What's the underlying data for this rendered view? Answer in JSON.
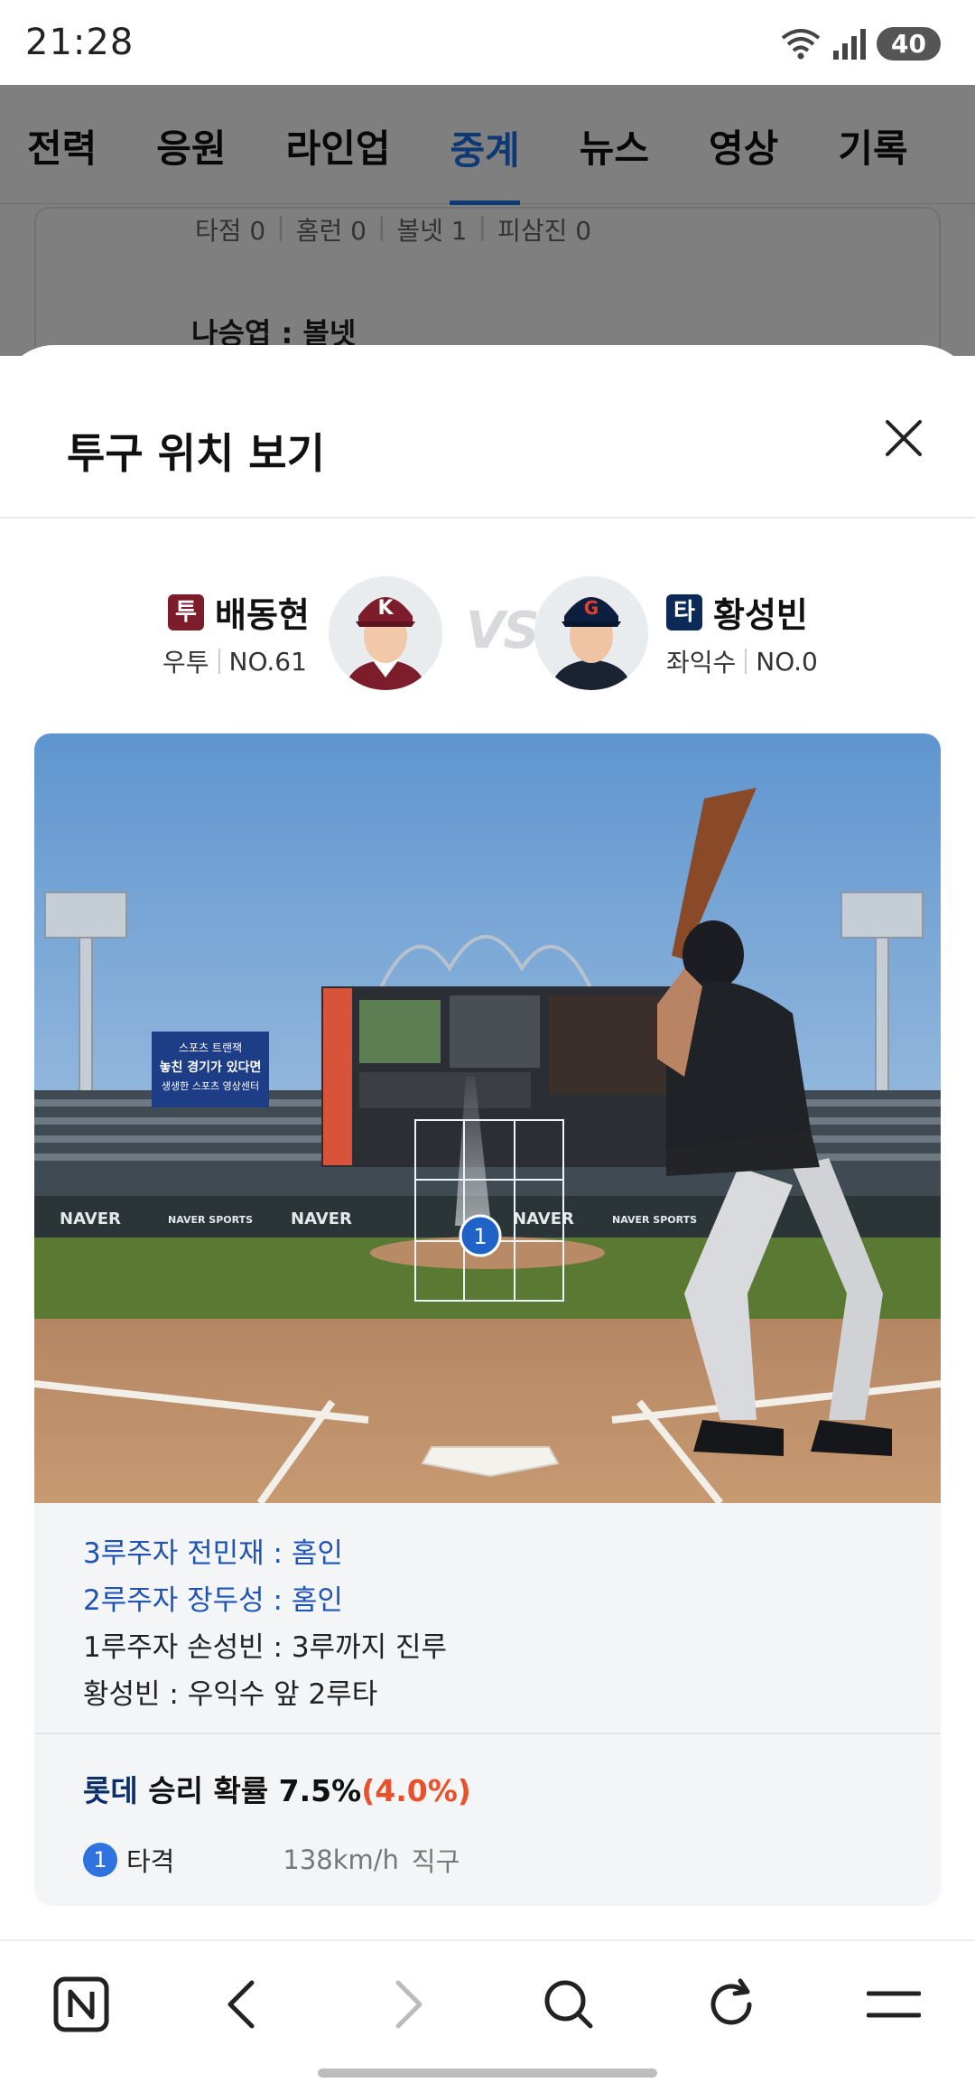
{
  "status_bar": {
    "time": "21:28",
    "battery": "40"
  },
  "background": {
    "tabs": [
      "전력",
      "응원",
      "라인업",
      "중계",
      "뉴스",
      "영상",
      "기록"
    ],
    "active_tab": "중계",
    "stats": [
      "타점 0",
      "홈런 0",
      "볼넷 1",
      "피삼진 0"
    ],
    "log_line": "나승엽 : 볼넷"
  },
  "sheet": {
    "title": "투구 위치 보기",
    "pitcher": {
      "badge": "투",
      "badge_color": "#7d1d2b",
      "name": "배동현",
      "position": "우투",
      "number": "NO.61"
    },
    "vs": "VS",
    "batter": {
      "badge": "타",
      "badge_color": "#0d2a57",
      "name": "황성빈",
      "position": "좌익수",
      "number": "NO.0"
    },
    "field": {
      "pitch_marker": "1",
      "board_text": [
        "NAVER",
        "NAVER SPORTS",
        "NAVER",
        "NAVER",
        "NAVER SPORTS"
      ],
      "scoreboard_ad": [
        "스포츠 트랜잭",
        "놓친 경기가 있다면",
        "생생한 스포츠 영상센터"
      ]
    },
    "plays": [
      {
        "text": "3루주자 전민재 : 홈인",
        "highlight": true
      },
      {
        "text": "2루주자 장두성 : 홈인",
        "highlight": true
      },
      {
        "text": "1루주자 손성빈 : 3루까지 진루",
        "highlight": false
      },
      {
        "text": "황성빈 : 우익수 앞 2루타",
        "highlight": false
      }
    ],
    "win_probability": {
      "team": "롯데",
      "label": "승리 확률",
      "value": "7.5%",
      "delta": "(4.0%)"
    },
    "pitch": {
      "number": "1",
      "result": "타격",
      "speed": "138km/h",
      "type": "직구"
    }
  },
  "nav": {
    "icons": [
      "naver-home-icon",
      "back-icon",
      "forward-icon",
      "search-icon",
      "refresh-icon",
      "menu-icon"
    ]
  }
}
